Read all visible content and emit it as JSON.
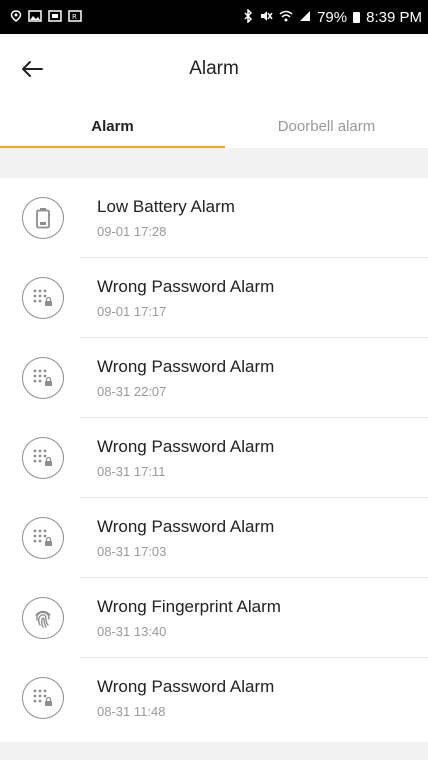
{
  "status_bar": {
    "battery_percent": "79%",
    "time": "8:39 PM"
  },
  "header": {
    "title": "Alarm"
  },
  "tabs": [
    {
      "label": "Alarm",
      "active": true
    },
    {
      "label": "Doorbell alarm",
      "active": false
    }
  ],
  "alarms": [
    {
      "title": "Low Battery Alarm",
      "time": "09-01 17:28",
      "icon": "battery-icon"
    },
    {
      "title": "Wrong Password Alarm",
      "time": "09-01 17:17",
      "icon": "keypad-lock-icon"
    },
    {
      "title": "Wrong Password Alarm",
      "time": "08-31 22:07",
      "icon": "keypad-lock-icon"
    },
    {
      "title": "Wrong Password Alarm",
      "time": "08-31 17:11",
      "icon": "keypad-lock-icon"
    },
    {
      "title": "Wrong Password Alarm",
      "time": "08-31 17:03",
      "icon": "keypad-lock-icon"
    },
    {
      "title": "Wrong Fingerprint Alarm",
      "time": "08-31 13:40",
      "icon": "fingerprint-icon"
    },
    {
      "title": "Wrong Password Alarm",
      "time": "08-31 11:48",
      "icon": "keypad-lock-icon"
    }
  ],
  "colors": {
    "accent": "#f5a623",
    "icon_stroke": "#8e8e8e",
    "secondary_text": "#9a9a9a"
  }
}
